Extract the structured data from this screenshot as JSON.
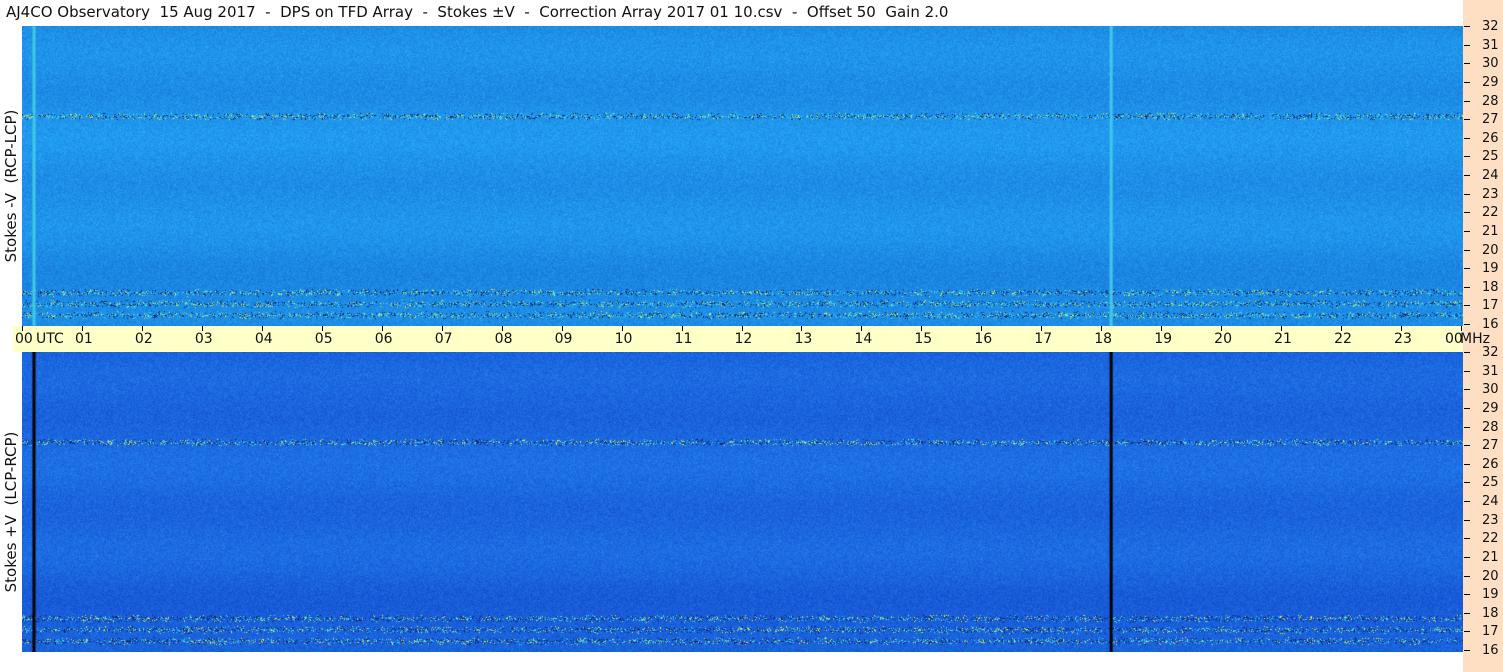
{
  "header": {
    "title": "AJ4CO Observatory  15 Aug 2017  -  DPS on TFD Array  -  Stokes ±V  -  Correction Array 2017 01 10.csv  -  Offset 50  Gain 2.0"
  },
  "chart_data": [
    {
      "type": "heatmap",
      "title": "",
      "ylabel": "Stokes -V  (RCP-LCP)",
      "xlabel": "UTC",
      "x_ticks": [
        "00",
        "01",
        "02",
        "03",
        "04",
        "05",
        "06",
        "07",
        "08",
        "09",
        "10",
        "11",
        "12",
        "13",
        "14",
        "15",
        "16",
        "17",
        "18",
        "19",
        "20",
        "21",
        "22",
        "23",
        "00"
      ],
      "y_unit": "MHz",
      "y_ticks": [
        16,
        17,
        18,
        19,
        20,
        21,
        22,
        23,
        24,
        25,
        26,
        27,
        28,
        29,
        30,
        31,
        32
      ],
      "y_range": [
        16,
        32
      ],
      "x_range_hours": [
        0,
        24
      ],
      "base_color": "#1d8ce6",
      "vertical_lines": [
        {
          "utc_hours": 0.2,
          "color": "#40c8e8"
        },
        {
          "utc_hours": 18.14,
          "color": "#40c8e8"
        }
      ],
      "bright_bands_mhz": [
        27.2,
        17.8,
        17.2,
        16.6
      ]
    },
    {
      "type": "heatmap",
      "title": "",
      "ylabel": "Stokes +V  (LCP-RCP)",
      "xlabel": "UTC",
      "x_ticks": [
        "00",
        "01",
        "02",
        "03",
        "04",
        "05",
        "06",
        "07",
        "08",
        "09",
        "10",
        "11",
        "12",
        "13",
        "14",
        "15",
        "16",
        "17",
        "18",
        "19",
        "20",
        "21",
        "22",
        "23",
        "00"
      ],
      "y_unit": "MHz",
      "y_ticks": [
        16,
        17,
        18,
        19,
        20,
        21,
        22,
        23,
        24,
        25,
        26,
        27,
        28,
        29,
        30,
        31,
        32
      ],
      "y_range": [
        16,
        32
      ],
      "x_range_hours": [
        0,
        24
      ],
      "base_color": "#1a62dc",
      "vertical_lines": [
        {
          "utc_hours": 0.2,
          "color": "#000000"
        },
        {
          "utc_hours": 18.14,
          "color": "#000000"
        }
      ],
      "bright_bands_mhz": [
        27.2,
        17.8,
        17.2,
        16.6
      ]
    }
  ],
  "axis": {
    "utc_label": "UTC",
    "mhz_label": "MHz"
  }
}
